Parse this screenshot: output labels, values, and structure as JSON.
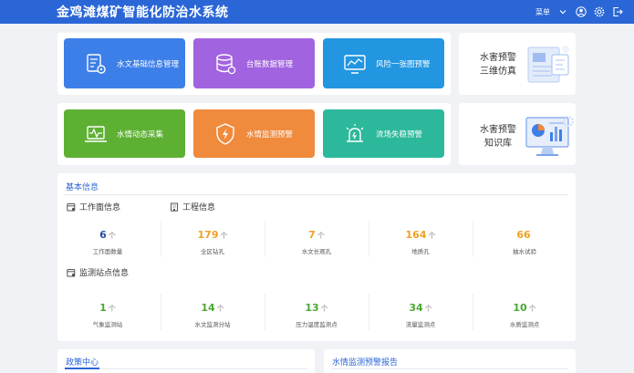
{
  "header": {
    "title": "金鸡滩煤矿智能化防治水系统",
    "menu_label": "菜单"
  },
  "tiles": [
    {
      "label": "水文基础信息管理",
      "color": "#3d7fe8"
    },
    {
      "label": "台账数据管理",
      "color": "#a263e0"
    },
    {
      "label": "风险一张图预警",
      "color": "#2296e0"
    },
    {
      "label": "水情动态采集",
      "color": "#5eb033"
    },
    {
      "label": "水情监测预警",
      "color": "#f08a3c"
    },
    {
      "label": "流场失稳预警",
      "color": "#2cb89a"
    }
  ],
  "side_cards": [
    {
      "line1": "水害预警",
      "line2": "三维仿真"
    },
    {
      "line1": "水害预警",
      "line2": "知识库"
    }
  ],
  "basic_info": {
    "title": "基本信息",
    "work_face_title": "工作面信息",
    "project_title": "工程信息",
    "stats_row1": [
      {
        "value": "6",
        "unit": "个",
        "label": "工作面数量",
        "color": "#2a4fa8"
      },
      {
        "value": "179",
        "unit": "个",
        "label": "全区钻孔",
        "color": "#f0a020"
      },
      {
        "value": "7",
        "unit": "个",
        "label": "水文长观孔",
        "color": "#f0a020"
      },
      {
        "value": "164",
        "unit": "个",
        "label": "地质孔",
        "color": "#f0a020"
      },
      {
        "value": "66",
        "unit": "",
        "label": "抽水试验",
        "color": "#f0a020"
      }
    ],
    "station_title": "监测站点信息",
    "stats_row2": [
      {
        "value": "1",
        "unit": "个",
        "label": "气象监测站",
        "color": "#4aa832"
      },
      {
        "value": "14",
        "unit": "个",
        "label": "水文监测分站",
        "color": "#4aa832"
      },
      {
        "value": "13",
        "unit": "个",
        "label": "压力温度监测点",
        "color": "#4aa832"
      },
      {
        "value": "34",
        "unit": "个",
        "label": "流量监测点",
        "color": "#4aa832"
      },
      {
        "value": "10",
        "unit": "个",
        "label": "水质监测点",
        "color": "#4aa832"
      }
    ]
  },
  "bottom": {
    "left_title": "政策中心",
    "right_title": "水情监测预警报告"
  }
}
